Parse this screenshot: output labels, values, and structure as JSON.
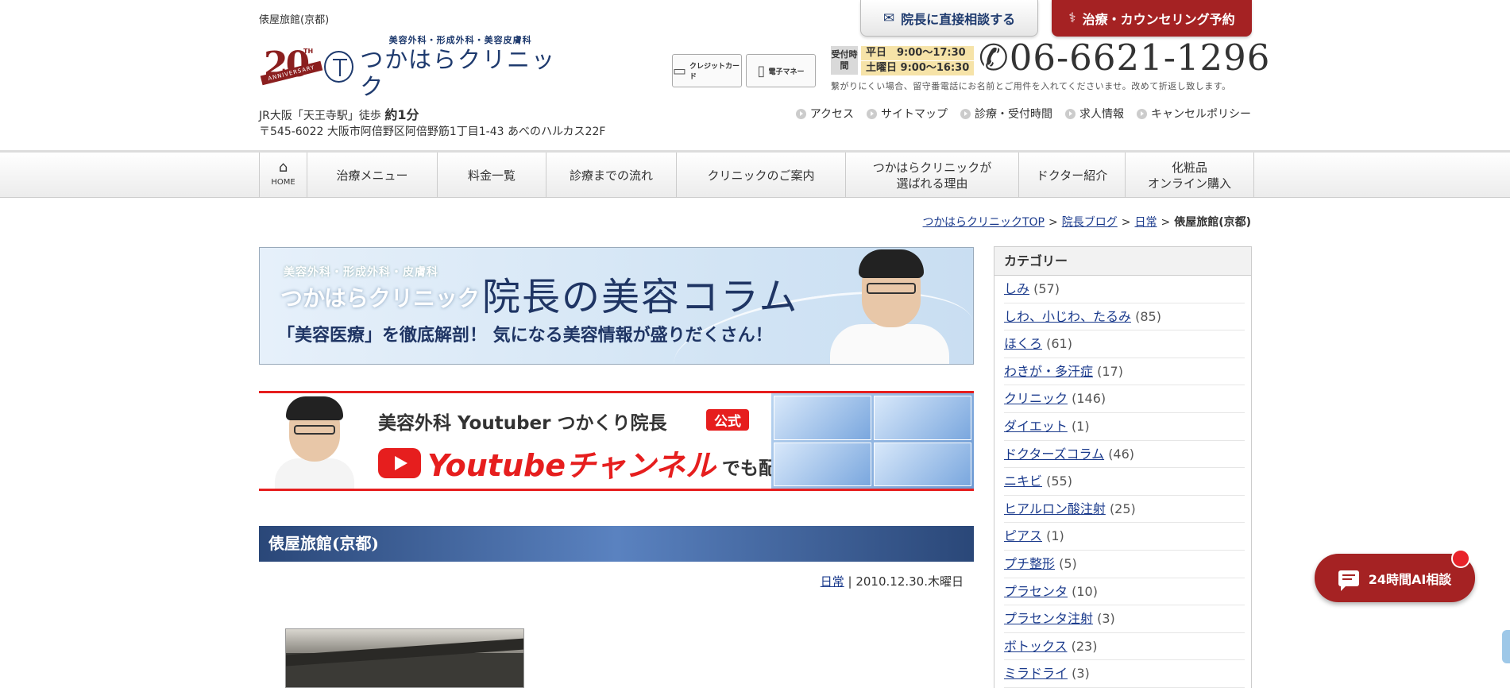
{
  "header": {
    "site_title": "俵屋旅館(京都)",
    "logo": {
      "anniversary_number": "20",
      "anniversary_th": "TH",
      "anniversary_text": "ANNIVERSARY",
      "subtitle": "美容外科・形成外科・美容皮膚科",
      "name": "つかはらクリニック"
    },
    "access_prefix": "JR大阪「天王寺駅」徒歩",
    "access_time": "約1分",
    "address": "〒545-6022 大阪市阿倍野区阿倍野筋1丁目1-43 あべのハルカス22F",
    "consult_button": "院長に直接相談する",
    "reserve_button": "治療・カウンセリング予約",
    "payment": {
      "credit": "クレジットカード",
      "emoney": "電子マネー"
    },
    "hours_label": "受付時間",
    "hours_weekday": "平日　9:00〜17:30",
    "hours_saturday": "土曜日 9:00〜16:30",
    "phone": "06-6621-1296",
    "phone_note": "繋がりにくい場合、留守番電話にお名前とご用件を入れてくださいませ。改めて折返し致します。",
    "util_nav": [
      "アクセス",
      "サイトマップ",
      "診療・受付時間",
      "求人情報",
      "キャンセルポリシー"
    ]
  },
  "gnav": {
    "home": "HOME",
    "items": [
      {
        "label": "治療メニュー"
      },
      {
        "label": "料金一覧"
      },
      {
        "label": "診療までの流れ"
      },
      {
        "label": "クリニックのご案内"
      },
      {
        "label": "つかはらクリニックが\n選ばれる理由"
      },
      {
        "label": "ドクター紹介"
      },
      {
        "label": "化粧品\nオンライン購入"
      }
    ]
  },
  "breadcrumb": {
    "items": [
      "つかはらクリニックTOP",
      "院長ブログ",
      "日常"
    ],
    "separator": ">",
    "current": "俵屋旅館(京都)"
  },
  "banner_column": {
    "subtitle": "美容外科・形成外科・皮膚科",
    "brand": "つかはらクリニック",
    "title": "院長の美容コラム",
    "tagline": "「美容医療」を徹底解剖！ 気になる美容情報が盛りだくさん！"
  },
  "banner_youtube": {
    "top": "美容外科 Youtuber つかくり院長",
    "badge": "公式",
    "channel": "Youtubeチャンネル",
    "after": "でも配信中"
  },
  "post": {
    "title": "俵屋旅館(京都)",
    "category": "日常",
    "date": "2010.12.30.木曜日"
  },
  "sidebar": {
    "heading": "カテゴリー",
    "categories": [
      {
        "name": "しみ",
        "count": "(57)"
      },
      {
        "name": "しわ、小じわ、たるみ",
        "count": "(85)"
      },
      {
        "name": "ほくろ",
        "count": "(61)"
      },
      {
        "name": "わきが・多汗症",
        "count": "(17)"
      },
      {
        "name": "クリニック",
        "count": "(146)"
      },
      {
        "name": "ダイエット",
        "count": "(1)"
      },
      {
        "name": "ドクターズコラム",
        "count": "(46)"
      },
      {
        "name": "ニキビ",
        "count": "(55)"
      },
      {
        "name": "ヒアルロン酸注射",
        "count": "(25)"
      },
      {
        "name": "ピアス",
        "count": "(1)"
      },
      {
        "name": "プチ整形",
        "count": "(5)"
      },
      {
        "name": "プラセンタ",
        "count": "(10)"
      },
      {
        "name": "プラセンタ注射",
        "count": "(3)"
      },
      {
        "name": "ボトックス",
        "count": "(23)"
      },
      {
        "name": "ミラドライ",
        "count": "(3)"
      }
    ]
  },
  "ai_chat": {
    "label": "24時間AI相談"
  },
  "colors": {
    "brand_red": "#a52223",
    "navy": "#1e3a6e",
    "link": "#1a3a8c",
    "youtube_red": "#e61e1e"
  }
}
